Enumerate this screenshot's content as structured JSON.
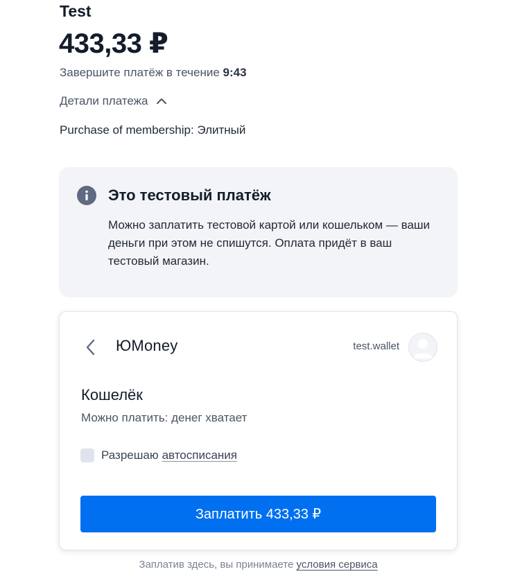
{
  "header": {
    "shop_name": "Test",
    "amount": "433,33 ₽",
    "timer_prefix": "Завершите платёж в течение",
    "timer_value": "9:43",
    "details_label": "Детали платежа",
    "details_icon": "chevron-up-icon",
    "purpose": "Purchase of membership: Элитный"
  },
  "test_notice": {
    "icon": "info-icon",
    "title": "Это тестовый платёж",
    "text": "Можно заплатить тестовой картой или кошельком — ваши деньги при этом не спишутся. Оплата придёт в ваш тестовый магазин."
  },
  "wallet_card": {
    "back_icon": "chevron-left-icon",
    "method_title": "ЮMoney",
    "account_name": "test.wallet",
    "avatar_icon": "user-avatar-icon",
    "wallet_label": "Кошелёк",
    "wallet_status": "Можно платить: денег хватает",
    "autopay_prefix": "Разрешаю",
    "autopay_link": "автосписания",
    "autopay_checked": false,
    "pay_button": "Заплатить 433,33 ₽"
  },
  "footer": {
    "terms_prefix": "Заплатив здесь, вы принимаете",
    "terms_link": "условия сервиса"
  },
  "colors": {
    "accent": "#0070f0",
    "notice_background": "#f3f4f7",
    "text_primary": "#141c2b",
    "text_secondary": "#4a5466"
  }
}
